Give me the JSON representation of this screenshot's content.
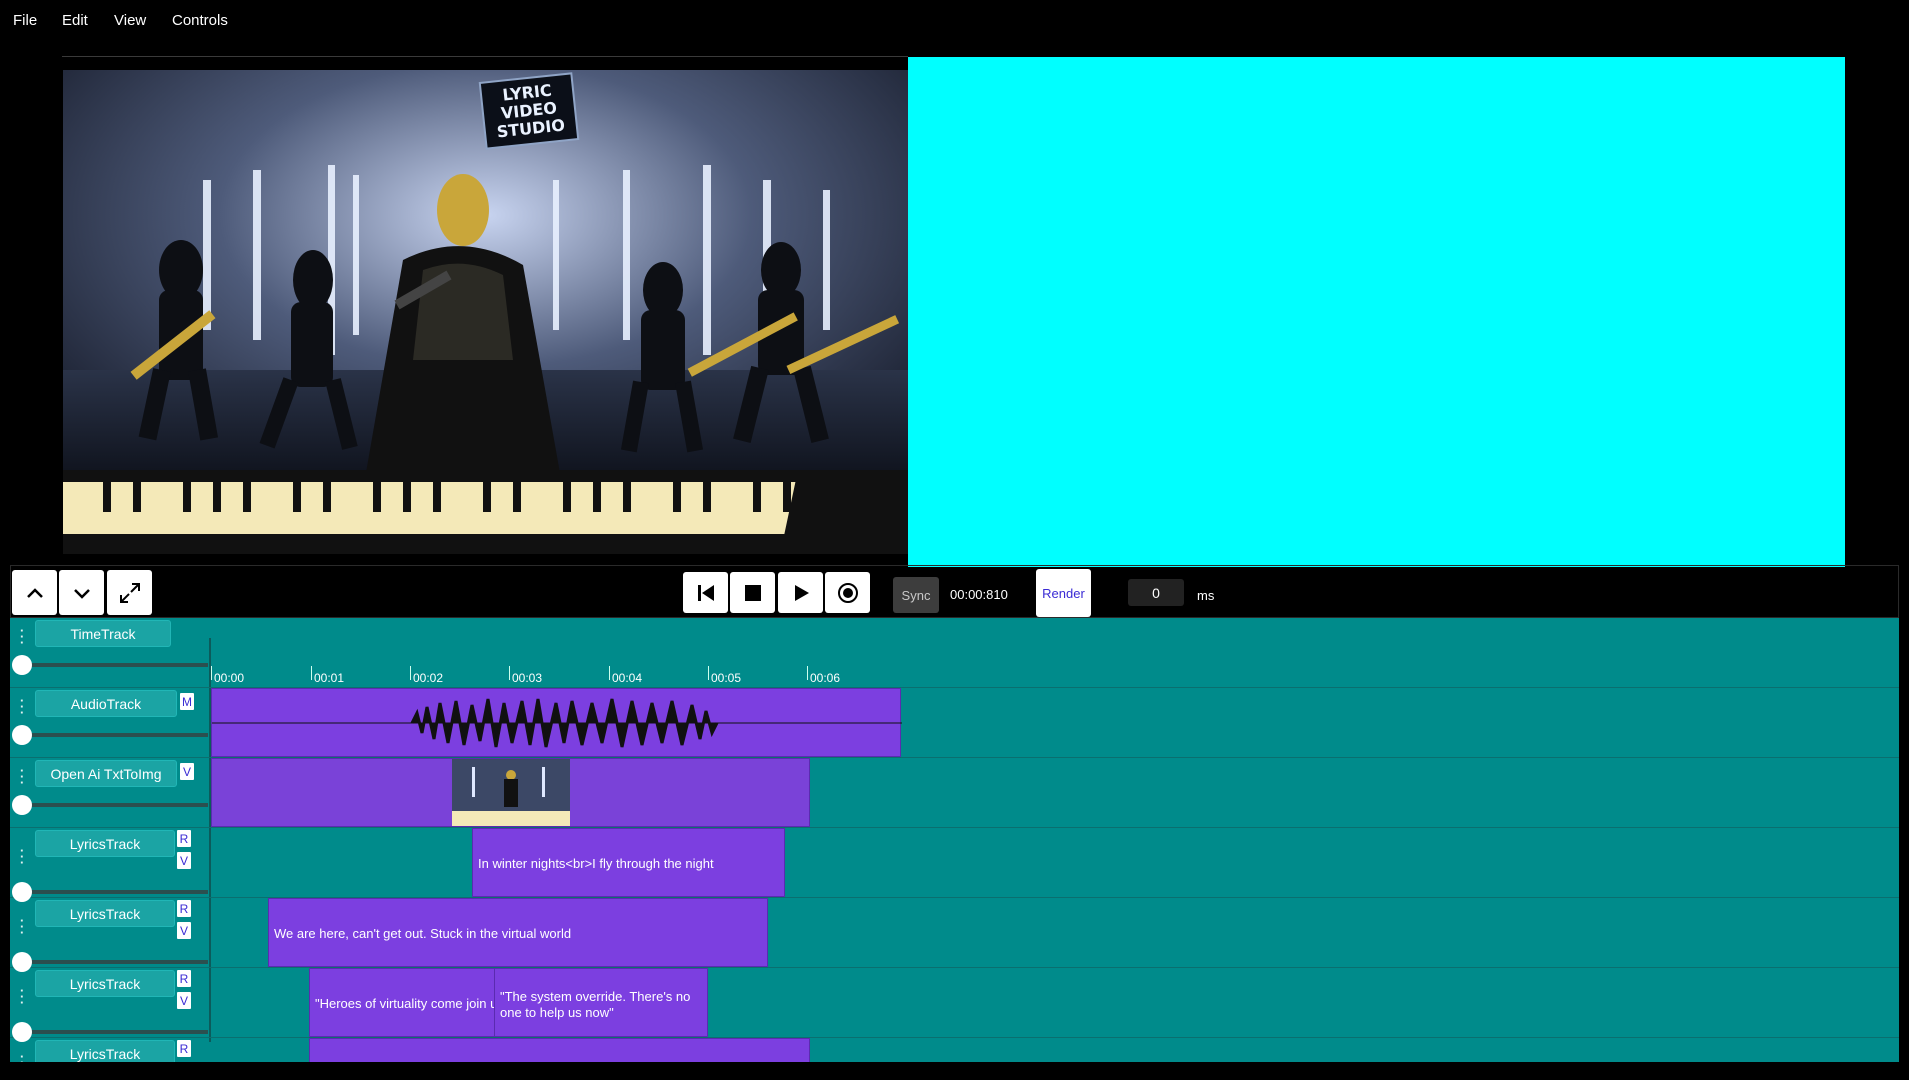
{
  "menu": {
    "file": "File",
    "edit": "Edit",
    "view": "View",
    "controls": "Controls"
  },
  "preview": {
    "sign_lines": [
      "LYRIC",
      "VIDEO",
      "STUDIO"
    ],
    "accent_color": "#00ffff"
  },
  "controls": {
    "sync_label": "Sync",
    "timecode": "00:00:810",
    "render_label": "Render",
    "offset_value": "0",
    "offset_unit": "ms"
  },
  "ruler": [
    "00:00",
    "00:01",
    "00:02",
    "00:03",
    "00:04",
    "00:05",
    "00:06"
  ],
  "tracks": {
    "time": {
      "label": "TimeTrack"
    },
    "audio": {
      "label": "AudioTrack",
      "tag_m": "M"
    },
    "image": {
      "label": "Open Ai TxtToImg",
      "tag_v": "V"
    },
    "lyrics1": {
      "label": "LyricsTrack",
      "tag_r": "R",
      "tag_v": "V",
      "clip_text": "In winter nights<br>I fly through the night"
    },
    "lyrics2": {
      "label": "LyricsTrack",
      "tag_r": "R",
      "tag_v": "V",
      "clip_text": "We are here, can't get out. Stuck in the virtual world"
    },
    "lyrics3": {
      "label": "LyricsTrack",
      "tag_r": "R",
      "tag_v": "V",
      "clip_text_a": "\"Heroes of virtuality come join us",
      "clip_text_b": "\"The system override. There's no one to help us now\""
    },
    "lyrics4": {
      "label": "LyricsTrack",
      "tag_r": "R"
    }
  },
  "colors": {
    "timeline_bg": "#008b8b",
    "clip": "#7c3fe0",
    "cyan_panel": "#00ffff"
  }
}
